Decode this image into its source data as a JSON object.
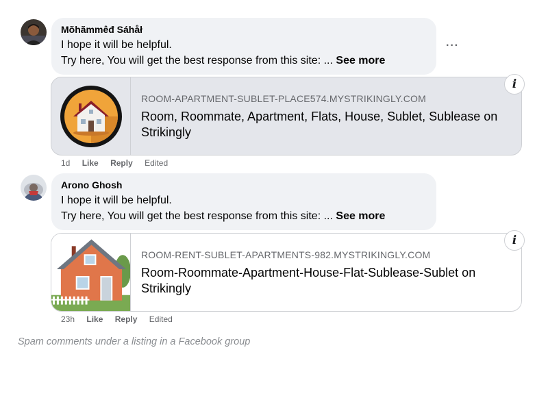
{
  "comments": [
    {
      "author": "Mõhãmmêđ Sáhåł",
      "line1": "I hope it will be helpful.",
      "line2": "Try here, You will get the best response from this site: ...",
      "see_more": "See more",
      "more_options": "···",
      "link": {
        "domain": "ROOM-APARTMENT-SUBLET-PLACE574.MYSTRIKINGLY.COM",
        "title": "Room, Roommate, Apartment, Flats, House, Sublet, Sublease on Strikingly"
      },
      "time": "1d",
      "like": "Like",
      "reply": "Reply",
      "edited": "Edited"
    },
    {
      "author": "Arono Ghosh",
      "line1": "I hope it will be helpful.",
      "line2": "Try here, You will get the best response from this site: ...",
      "see_more": "See more",
      "link": {
        "domain": "ROOM-RENT-SUBLET-APARTMENTS-982.MYSTRIKINGLY.COM",
        "title": "Room-Roommate-Apartment-House-Flat-Sublease-Sublet on Strikingly"
      },
      "time": "23h",
      "like": "Like",
      "reply": "Reply",
      "edited": "Edited"
    }
  ],
  "info_icon": "i",
  "caption": "Spam comments under a listing in a Facebook group",
  "colors": {
    "bubble": "#f0f2f5",
    "card_gray": "#e4e6eb",
    "meta_text": "#65676b",
    "caption": "#8a8d91"
  },
  "icons": [
    "avatar",
    "more-options-icon",
    "info-icon",
    "house-thumbnail"
  ]
}
